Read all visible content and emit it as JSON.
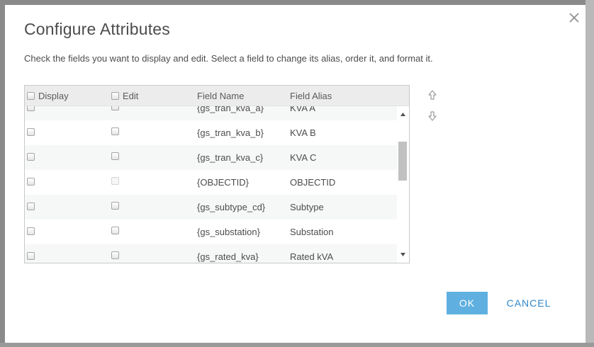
{
  "dialog": {
    "title": "Configure Attributes",
    "instructions": "Check the fields you want to display and edit. Select a field to change its alias, order it, and format it.",
    "ok_label": "OK",
    "cancel_label": "CANCEL"
  },
  "table": {
    "headers": {
      "display": "Display",
      "edit": "Edit",
      "field_name": "Field Name",
      "field_alias": "Field Alias"
    },
    "rows": [
      {
        "name": "{gs_tran_kva_a}",
        "alias": "KVA A",
        "display": false,
        "edit": false,
        "edit_disabled": false
      },
      {
        "name": "{gs_tran_kva_b}",
        "alias": "KVA B",
        "display": false,
        "edit": false,
        "edit_disabled": false
      },
      {
        "name": "{gs_tran_kva_c}",
        "alias": "KVA C",
        "display": false,
        "edit": false,
        "edit_disabled": false
      },
      {
        "name": "{OBJECTID}",
        "alias": "OBJECTID",
        "display": false,
        "edit": false,
        "edit_disabled": true
      },
      {
        "name": "{gs_subtype_cd}",
        "alias": "Subtype",
        "display": false,
        "edit": false,
        "edit_disabled": false
      },
      {
        "name": "{gs_substation}",
        "alias": "Substation",
        "display": false,
        "edit": false,
        "edit_disabled": false
      },
      {
        "name": "{gs_rated_kva}",
        "alias": "Rated kVA",
        "display": false,
        "edit": false,
        "edit_disabled": false
      }
    ]
  },
  "icons": {
    "close": "close-icon",
    "move_up": "arrow-up-icon",
    "move_down": "arrow-down-icon",
    "scroll_up": "triangle-up-icon",
    "scroll_down": "triangle-down-icon"
  },
  "colors": {
    "primary": "#5fafe0",
    "link": "#2f86c9",
    "header_bg": "#ececec",
    "row_alt_bg": "#f6f7f7"
  }
}
